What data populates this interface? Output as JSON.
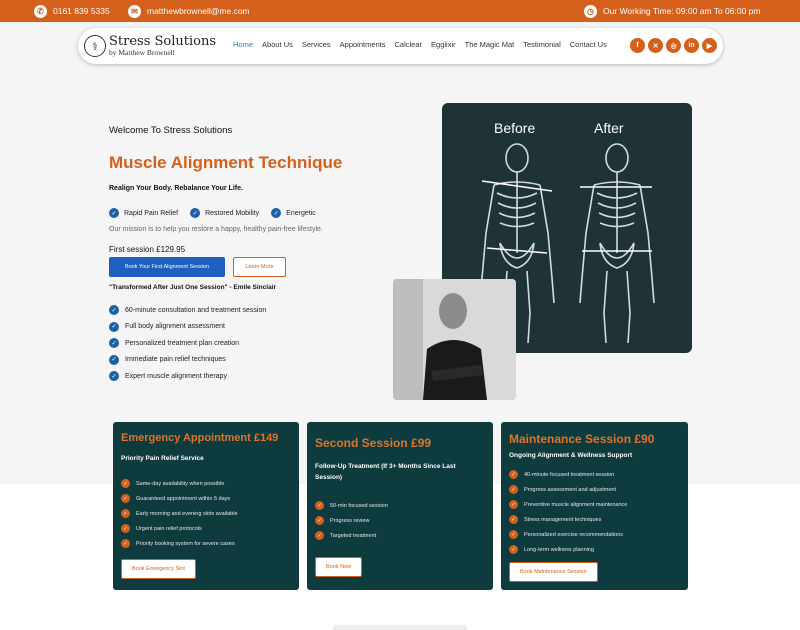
{
  "topbar": {
    "phone": "0161 839 5335",
    "email": "matthewbrownell@me.com",
    "hours": "Our Working Time: 09:00 am To 06:00 pm"
  },
  "header": {
    "logo_title": "Stress Solutions",
    "logo_sub": "by Matthew Brownell",
    "nav": [
      "Home",
      "About Us",
      "Services",
      "Appointments",
      "Calclear",
      "Egglixir",
      "The Magic Mat",
      "Testimonial",
      "Contact Us"
    ],
    "socials": [
      "facebook-icon",
      "x-icon",
      "instagram-icon",
      "linkedin-icon",
      "youtube-icon"
    ]
  },
  "hero": {
    "welcome": "Welcome To Stress Solutions",
    "title": "Muscle Alignment Technique",
    "tagline": "Realign Your Body. Rebalance Your Life.",
    "features": [
      "Rapid Pain Relief",
      "Restored Mobility",
      "Energetic"
    ],
    "mission": "Our mission is to help you restore a happy, healthy pain-free lifestyle.",
    "price": "First session £129.95",
    "cta_primary": "Book Your First Alignment Session",
    "cta_secondary": "Learn More",
    "quote": "\"Transformed After Just One Session\" - Emile Sinclair",
    "benefits": [
      "60-minute consultation and treatment session",
      "Full body alignment assessment",
      "Personalized treatment plan creation",
      "Immediate pain relief techniques",
      "Expert muscle alignment therapy"
    ],
    "before_label": "Before",
    "after_label": "After"
  },
  "cards": [
    {
      "title": "Emergency Appointment £149",
      "subtitle": "Priority Pain Relief Service",
      "items": [
        "Same-day availability when possible",
        "Guaranteed appointment within 5 days",
        "Early morning and evening slots available",
        "Urgent pain relief protocols",
        "Priority booking system for severe cases"
      ],
      "button": "Book Emergency Slot"
    },
    {
      "title": "Second Session £99",
      "subtitle": "Follow-Up Treatment (If 3+ Months Since Last Session)",
      "items": [
        "50-min focused session",
        "Progress review",
        "Targeted treatment"
      ],
      "button": "Book Now"
    },
    {
      "title": "Maintenance Session £90",
      "subtitle": "Ongoing Alignment & Wellness Support",
      "items": [
        "40-minute focused treatment session",
        "Progress assessment and adjustment",
        "Preventive muscle alignment maintenance",
        "Stress management techniques",
        "Personalized exercise recommendations",
        "Long-term wellness planning"
      ],
      "button": "Book Maintenance Session"
    }
  ],
  "colors": {
    "accent": "#d4601b",
    "card_bg": "#0e3b3e",
    "primary_btn": "#1f5fbf"
  }
}
